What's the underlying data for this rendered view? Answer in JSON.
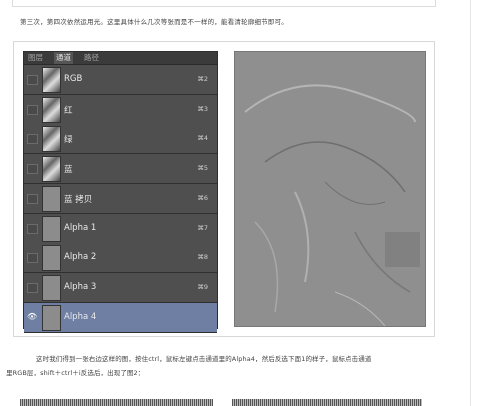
{
  "intro_text": "第三次，第四次依然运用光。这里具体什么几次等张而是不一样的，能看清轮廓细节即可。",
  "panel": {
    "tabs": [
      "图层",
      "通道",
      "路径"
    ],
    "active_tab": 1,
    "rows": [
      {
        "label": "RGB",
        "shortcut": "⌘2",
        "thumb": "image",
        "selected": false
      },
      {
        "label": "红",
        "shortcut": "⌘3",
        "thumb": "image",
        "selected": false
      },
      {
        "label": "绿",
        "shortcut": "⌘4",
        "thumb": "image",
        "selected": false
      },
      {
        "label": "蓝",
        "shortcut": "⌘5",
        "thumb": "image",
        "selected": false
      },
      {
        "label": "蓝 拷贝",
        "shortcut": "⌘6",
        "thumb": "plain",
        "selected": false
      },
      {
        "label": "Alpha 1",
        "shortcut": "⌘7",
        "thumb": "plain",
        "selected": false
      },
      {
        "label": "Alpha 2",
        "shortcut": "⌘8",
        "thumb": "plain",
        "selected": false
      },
      {
        "label": "Alpha 3",
        "shortcut": "⌘9",
        "thumb": "plain",
        "selected": false
      },
      {
        "label": "Alpha 4",
        "shortcut": "",
        "thumb": "plain",
        "selected": true
      }
    ]
  },
  "body_text_line1": "这时我们得到一张右边这样的图，按住ctrl，鼠标左键点击通道里的Alpha4，然后反选下面1的样子，鼠标点击通道",
  "body_text_line2": "里RGB层，shift＋ctrl＋i反选后，出现了图2：",
  "colors": {
    "selected_row": "#6e7fa3",
    "panel_bg": "#4f4f4f"
  }
}
